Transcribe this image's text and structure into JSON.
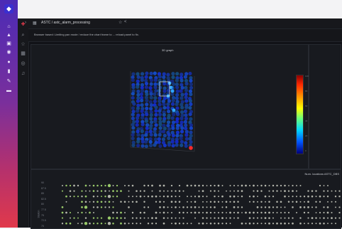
{
  "breadcrumb": "ASTC / astc_alarm_processing",
  "notice": "Browser based: Limiting pan mode / reduce the chart frame to ... reload panel to fix.",
  "panels": {
    "graph3d_title": "3D graph",
    "right_title": "Num. locations ASTC_DBS"
  },
  "yaxis": {
    "label": "Station",
    "ticks": [
      "90",
      "87.5",
      "85",
      "82.5",
      "80",
      "77.5",
      "75",
      "72.5",
      "70"
    ]
  },
  "colorbar": {
    "ticks": [
      "100",
      "80",
      "60",
      "40",
      "20",
      "0"
    ]
  },
  "colors": {
    "outer_sidebar_top": "#4b2bb6",
    "outer_sidebar_bottom": "#e0394b",
    "app_bg": "#111217",
    "panel_bg": "#181a1f",
    "cube_blue": "#1e3cc8",
    "dot_green": "#9acb6a",
    "dot_gray": "#b5b7ad"
  },
  "icons": {
    "outer_sidebar": [
      "home-icon",
      "alert-icon",
      "dashboard-icon",
      "camera-icon",
      "bell-icon",
      "book-icon",
      "pin-icon",
      "grid-icon"
    ],
    "app_sidebar": [
      "plus-icon",
      "search-icon",
      "star-icon",
      "apps-icon",
      "compass-icon",
      "bell-icon"
    ]
  }
}
